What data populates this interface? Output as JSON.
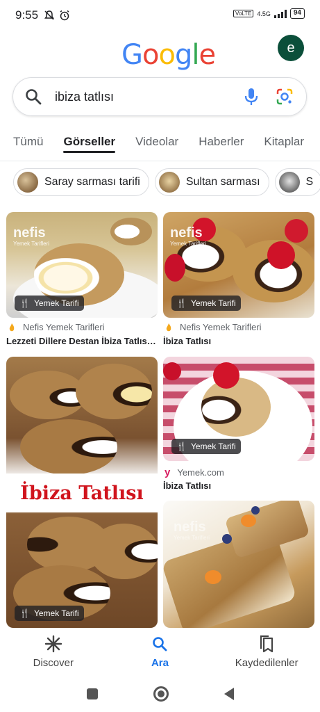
{
  "status_bar": {
    "time": "9:55",
    "network_type": "4.5G",
    "volte": "VoLTE",
    "battery": "94"
  },
  "header": {
    "logo_letters": [
      "G",
      "o",
      "o",
      "g",
      "l",
      "e"
    ],
    "logo_colors": [
      "#4285F4",
      "#EA4335",
      "#FBBC05",
      "#4285F4",
      "#34A853",
      "#EA4335"
    ],
    "avatar_letter": "e"
  },
  "search": {
    "query": "ibiza tatlısı"
  },
  "tabs": [
    "Tümü",
    "Görseller",
    "Videolar",
    "Haberler",
    "Kitaplar"
  ],
  "active_tab": "Görseller",
  "chips": [
    "Saray sarması tarifi",
    "Sultan sarması",
    "S"
  ],
  "results": [
    {
      "badge": "Yemek Tarifi",
      "source": "Nefis Yemek Tarifleri",
      "caption": "Lezzeti Dillere Destan İbiza Tatlısı ...",
      "watermark": "nefis",
      "watermark_sub": "Yemek Tarifleri"
    },
    {
      "badge": "Yemek Tarifi",
      "source": "Nefis Yemek Tarifleri",
      "caption": "İbiza Tatlısı",
      "watermark": "nefis",
      "watermark_sub": "Yemek Tarifleri"
    },
    {
      "badge": "Yemek Tarifi",
      "banner": "İbiza Tatlısı"
    },
    {
      "badge": "Yemek Tarifi",
      "source": "Yemek.com",
      "caption": "İbiza Tatlısı"
    },
    {
      "watermark": "nefis",
      "watermark_sub": "Yemek Tarifleri"
    }
  ],
  "bottom_nav": {
    "discover": "Discover",
    "search": "Ara",
    "saved": "Kaydedilenler"
  }
}
